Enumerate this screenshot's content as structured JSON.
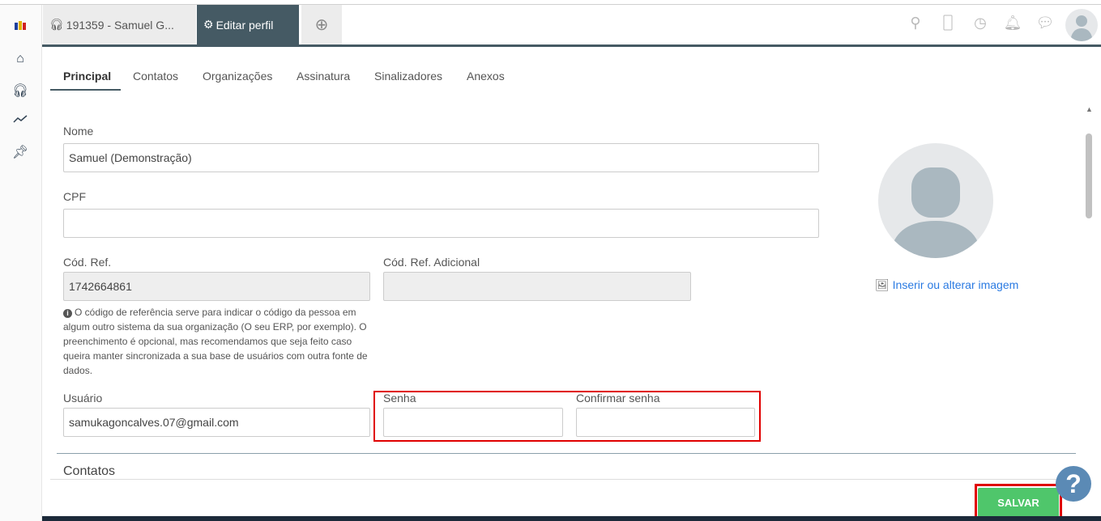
{
  "tabs": [
    {
      "label": "191359 - Samuel G..."
    },
    {
      "label": "Editar perfil"
    }
  ],
  "subtabs": [
    "Principal",
    "Contatos",
    "Organizações",
    "Assinatura",
    "Sinalizadores",
    "Anexos"
  ],
  "form": {
    "nome_label": "Nome",
    "nome_value": "Samuel (Demonstração)",
    "cpf_label": "CPF",
    "cpf_value": "",
    "codref_label": "Cód. Ref.",
    "codref_value": "1742664861",
    "codref_ad_label": "Cód. Ref. Adicional",
    "codref_ad_value": "",
    "help": "O código de referência serve para indicar o código da pessoa em algum outro sistema da sua organização (O seu ERP, por exemplo). O preenchimento é opcional, mas recomendamos que seja feito caso queira manter sincronizada a sua base de usuários com outra fonte de dados.",
    "usuario_label": "Usuário",
    "usuario_value": "samukagoncalves.07@gmail.com",
    "senha_label": "Senha",
    "confirmar_label": "Confirmar senha"
  },
  "section_contatos": "Contatos",
  "image_link": "Inserir ou alterar imagem",
  "save_label": "SALVAR",
  "help_button": "?",
  "colors": {
    "dark": "#455a64",
    "save": "#4fc66b",
    "highlight": "#e00000",
    "link": "#2a7ae2"
  }
}
